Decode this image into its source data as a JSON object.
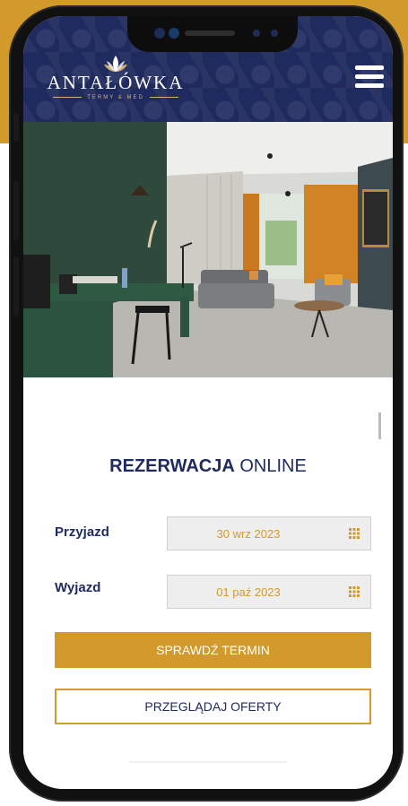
{
  "brand": {
    "name": "ANTAŁÓWKA",
    "tagline": "TERMY & MED"
  },
  "colors": {
    "brand_navy": "#1f2a5e",
    "accent_gold": "#d29a2a",
    "field_bg": "#eeeeee"
  },
  "header": {
    "menu_icon": "hamburger-menu-icon"
  },
  "hero": {
    "image": "hotel-room-photo"
  },
  "booking": {
    "title_bold": "REZERWACJA",
    "title_light": "ONLINE",
    "arrival_label": "Przyjazd",
    "arrival_value": "30 wrz 2023",
    "departure_label": "Wyjazd",
    "departure_value": "01 paź 2023",
    "calendar_icon": "calendar-grid-icon",
    "check_button": "SPRAWDŹ TERMIN",
    "offers_button": "PRZEGLĄDAJ OFERTY"
  }
}
